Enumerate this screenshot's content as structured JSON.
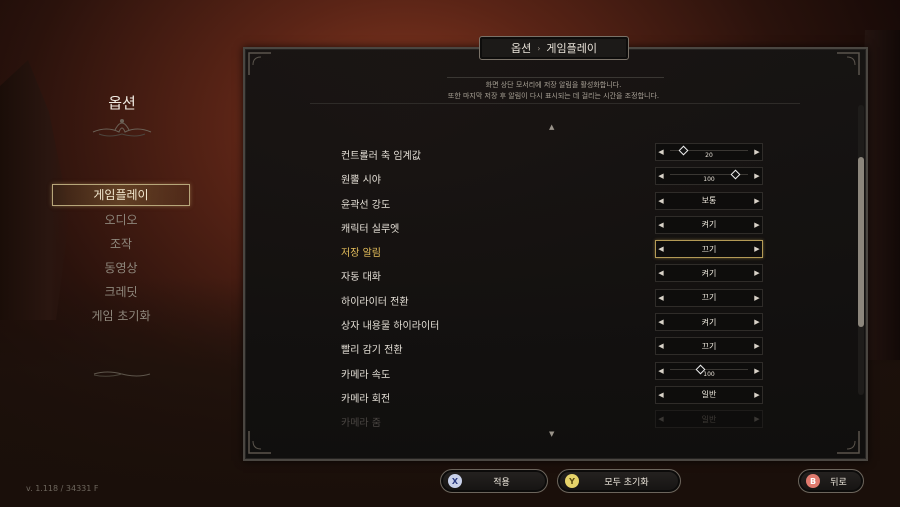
{
  "left_menu": {
    "title": "옵션",
    "items": [
      "게임플레이",
      "오디오",
      "조작",
      "동영상",
      "크레딧",
      "게임 초기화"
    ],
    "active_index": 0
  },
  "version": "v. 1.118 / 34331 F",
  "breadcrumb": {
    "parent": "옵션",
    "current": "게임플레이"
  },
  "description": {
    "line1": "화면 상단 모서리에 저장 알림을 활성화합니다.",
    "line2": "또한 마지막 저장 후 알림이 다시 표시되는 데 걸리는 시간을 조정합니다."
  },
  "settings": [
    {
      "label": "컨트롤러 축 임계값",
      "type": "slider",
      "value": "20",
      "level": 0.2
    },
    {
      "label": "원뿔 시야",
      "type": "slider",
      "value": "100",
      "level": 0.8
    },
    {
      "label": "윤곽선 강도",
      "type": "select",
      "value": "보통"
    },
    {
      "label": "캐릭터 실루엣",
      "type": "select",
      "value": "켜기"
    },
    {
      "label": "저장 알림",
      "type": "select",
      "value": "끄기",
      "highlight": true
    },
    {
      "label": "자동 대화",
      "type": "select",
      "value": "켜기"
    },
    {
      "label": "하이라이터 전환",
      "type": "select",
      "value": "끄기"
    },
    {
      "label": "상자 내용물 하이라이터",
      "type": "select",
      "value": "켜기"
    },
    {
      "label": "빨리 감기 전환",
      "type": "select",
      "value": "끄기"
    },
    {
      "label": "카메라 속도",
      "type": "slider",
      "value": "100",
      "level": 0.4
    },
    {
      "label": "카메라 회전",
      "type": "select",
      "value": "일반"
    },
    {
      "label": "카메라 줌",
      "type": "select",
      "value": "일반",
      "faded": true
    }
  ],
  "buttons": {
    "apply": {
      "glyph": "X",
      "label": "적용"
    },
    "reset_all": {
      "glyph": "Y",
      "label": "모두 초기화"
    },
    "back": {
      "glyph": "B",
      "label": "뒤로"
    }
  },
  "colors": {
    "highlight_text": "#e6bf5c",
    "highlight_border": "#b39a56",
    "panel_bg": "#161514"
  }
}
